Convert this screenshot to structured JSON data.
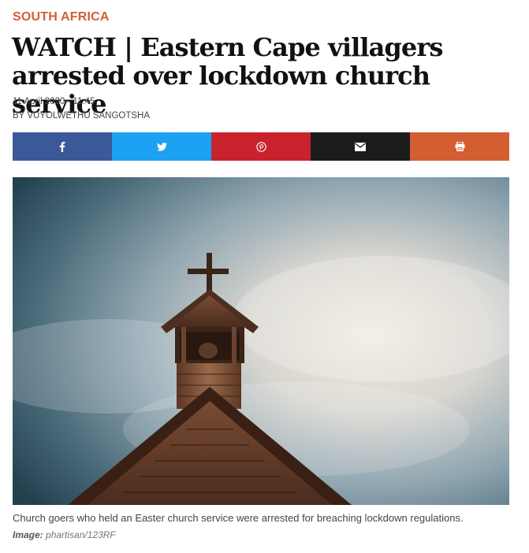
{
  "article": {
    "section": "SOUTH AFRICA",
    "headline": "WATCH | Eastern Cape villagers arrested over lockdown church service",
    "date": "11 April 2020 - 11:45",
    "byline": "BY VUYOLWETHU SANGOTSHA"
  },
  "share": {
    "buttons": [
      {
        "icon": "facebook-icon",
        "color": "#3b5998"
      },
      {
        "icon": "twitter-icon",
        "color": "#1da1f2"
      },
      {
        "icon": "pinterest-icon",
        "color": "#c8232c"
      },
      {
        "icon": "email-icon",
        "color": "#1c1c1c"
      },
      {
        "icon": "print-icon",
        "color": "#d35e32"
      }
    ]
  },
  "image": {
    "caption": "Church goers who held an Easter church service were arrested for breaching lockdown regulations.",
    "credit_label": "Image:",
    "credit_value": "phartisan/123RF"
  },
  "colors": {
    "accent": "#d35e32"
  }
}
